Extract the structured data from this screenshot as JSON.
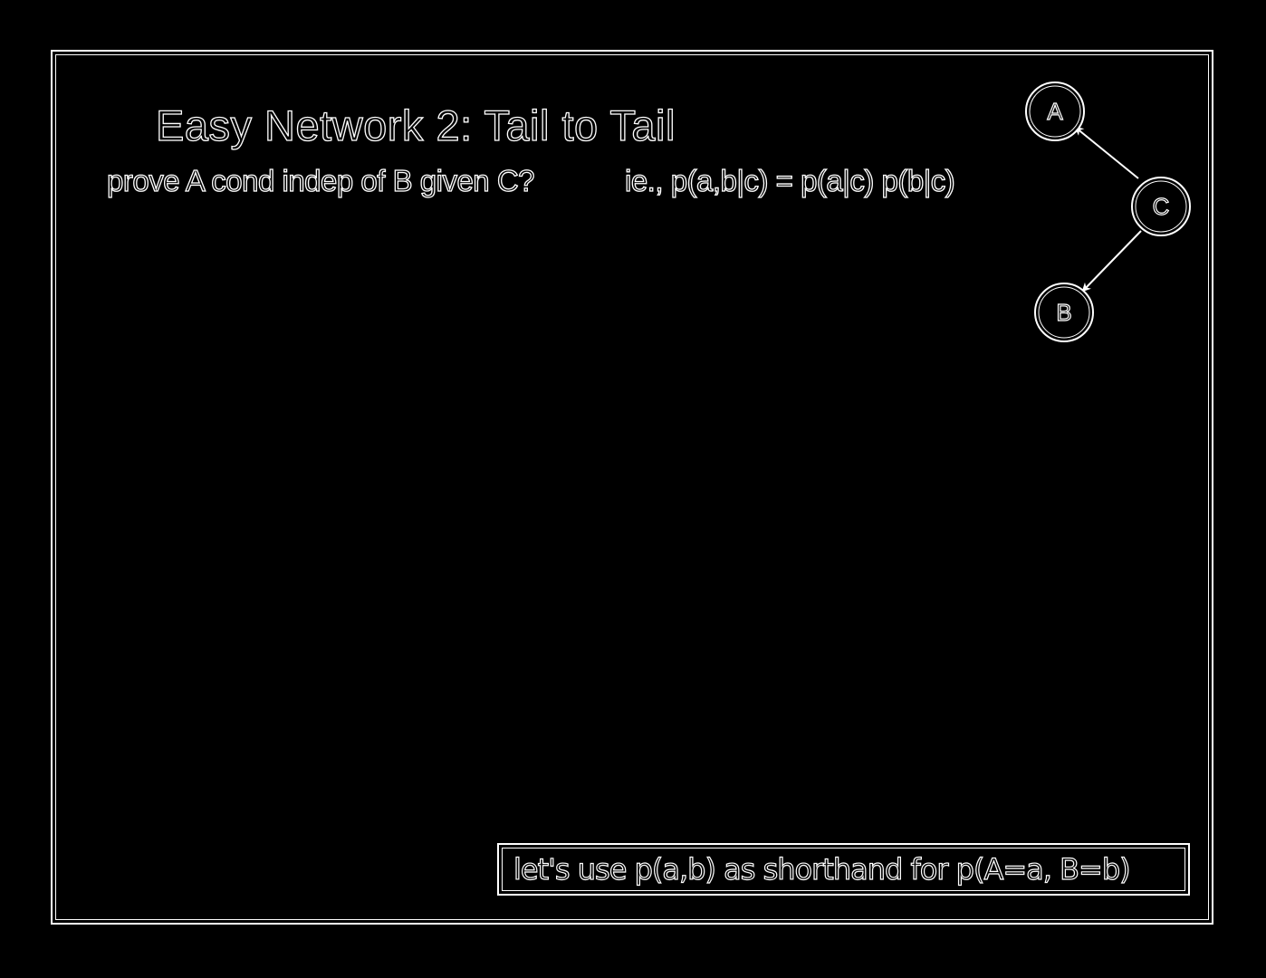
{
  "slide": {
    "title": "Easy Network 2: Tail to Tail",
    "question": "prove A cond indep of B given C?",
    "formula": "ie., p(a,b|c) = p(a|c) p(b|c)",
    "note": "let's use p(a,b) as shorthand for p(A=a, B=b)"
  },
  "diagram": {
    "nodes": [
      {
        "id": "A",
        "label": "A"
      },
      {
        "id": "C",
        "label": "C"
      },
      {
        "id": "B",
        "label": "B"
      }
    ],
    "edges": [
      {
        "from": "C",
        "to": "A"
      },
      {
        "from": "C",
        "to": "B"
      }
    ]
  },
  "colors": {
    "background": "#000000",
    "foreground": "#ffffff"
  }
}
